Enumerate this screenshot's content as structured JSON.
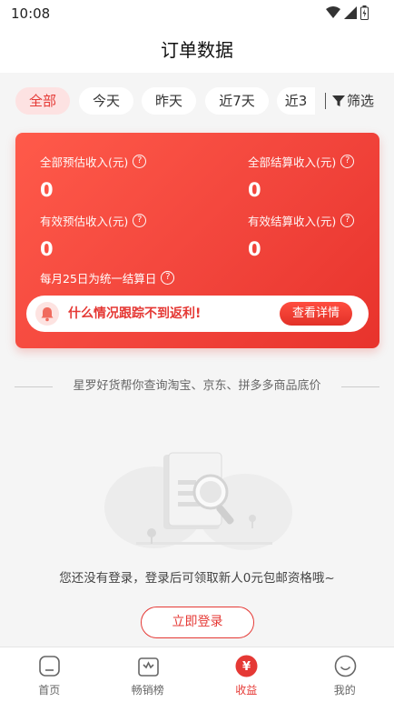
{
  "status_bar": {
    "time": "10:08"
  },
  "header": {
    "title": "订单数据"
  },
  "filters": {
    "chips": [
      {
        "label": "全部",
        "active": true
      },
      {
        "label": "今天",
        "active": false
      },
      {
        "label": "昨天",
        "active": false
      },
      {
        "label": "近7天",
        "active": false
      },
      {
        "label": "近3",
        "active": false
      }
    ],
    "filter_label": "筛选"
  },
  "summary": {
    "stats": [
      {
        "label": "全部预估收入(元)",
        "value": "0"
      },
      {
        "label": "全部结算收入(元)",
        "value": "0"
      },
      {
        "label": "有效预估收入(元)",
        "value": "0"
      },
      {
        "label": "有效结算收入(元)",
        "value": "0"
      }
    ],
    "settlement_note": "每月25日为统一结算日",
    "notice_text": "什么情况跟踪不到返利!",
    "detail_button": "查看详情"
  },
  "promo_text": "星罗好货帮你查询淘宝、京东、拼多多商品底价",
  "empty_state": {
    "message": "您还没有登录，登录后可领取新人0元包邮资格哦~",
    "login_button": "立即登录"
  },
  "tabbar": {
    "items": [
      {
        "label": "首页",
        "icon": "home-icon",
        "active": false
      },
      {
        "label": "畅销榜",
        "icon": "bestseller-icon",
        "active": false
      },
      {
        "label": "收益",
        "icon": "yuan-icon",
        "active": true
      },
      {
        "label": "我的",
        "icon": "profile-icon",
        "active": false
      }
    ]
  },
  "colors": {
    "accent": "#e53935",
    "card_start": "#ff5a4a",
    "card_end": "#e8332c"
  }
}
